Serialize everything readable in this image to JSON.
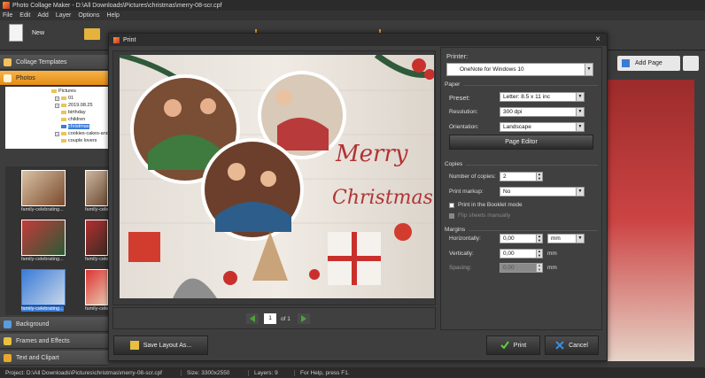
{
  "app": {
    "title": "Photo Collage Maker - D:\\All Downloads\\Pictures\\christmas\\merry-08-scr.cpf",
    "menu": [
      "File",
      "Edit",
      "Add",
      "Layer",
      "Options",
      "Help"
    ]
  },
  "toolbar": {
    "new_label": "New",
    "open_label": "O"
  },
  "left_panel": {
    "collage_templates": "Collage Templates",
    "photos": "Photos",
    "background": "Background",
    "frames_effects": "Frames and Effects",
    "text_clipart": "Text and Clipart"
  },
  "tree": {
    "items": [
      "Pictures",
      "01",
      "2019.08.25",
      "birthday",
      "children",
      "christmas",
      "cookies-cakes-and",
      "couple lovers"
    ]
  },
  "thumbnails": [
    "family-celebrating...",
    "family-celebrati...",
    "family-celebrating...",
    "family-celebrati...",
    "family-celebrating...",
    "family-celebrati..."
  ],
  "right_panel": {
    "add_page_label": "Add Page"
  },
  "dialog": {
    "title": "Print",
    "close": "×",
    "printer_section": "Printer:",
    "printer_name": "OneNote for Windows 10",
    "paper_section": "Paper",
    "preset_label": "Preset:",
    "preset_value": "Letter: 8.5 x 11 inc",
    "resolution_label": "Resolution:",
    "resolution_value": "300 dpi",
    "orientation_label": "Orientation:",
    "orientation_value": "Landscape",
    "page_editor": "Page Editor",
    "copies_section": "Copies",
    "copies_label": "Number of copies:",
    "copies_value": "2",
    "markup_label": "Print markup:",
    "markup_value": "No",
    "booklet_label": "Print in the Booklet mode",
    "flip_label": "Flip sheets manually",
    "margins_section": "Margins",
    "horizontally_label": "Horizontally:",
    "horizontally_value": "0,00",
    "vertically_label": "Vertically:",
    "vertically_value": "0,00",
    "spacing_label": "Spacing:",
    "spacing_value": "0,00",
    "unit_value": "mm",
    "unit_v": "mm",
    "unit_s": "mm",
    "page_current": "1",
    "page_of": "of 1",
    "save_layout": "Save Layout As...",
    "print_button": "Print",
    "cancel_button": "Cancel",
    "collage_text_1": "Merry",
    "collage_text_2": "Christmas!"
  },
  "status": {
    "project": "Project: D:\\All Downloads\\Pictures\\christmas\\merry-08-scr.cpf",
    "size": "Size: 3300x2550",
    "layers": "Layers: 9",
    "help": "For Help, press F1."
  }
}
